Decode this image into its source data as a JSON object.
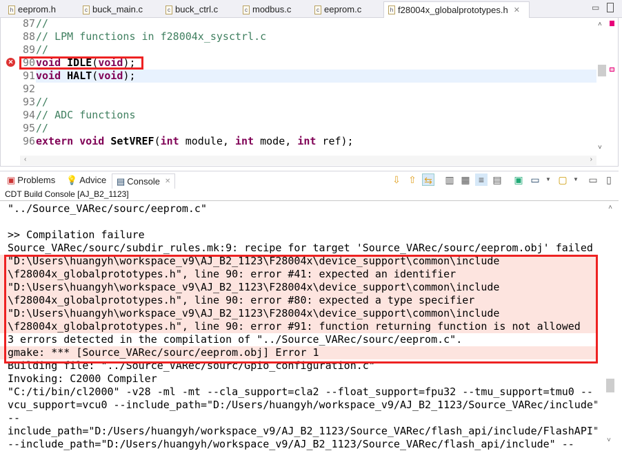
{
  "editor_tabs": [
    {
      "label": "eeprom.h",
      "icon": "h-file-icon"
    },
    {
      "label": "buck_main.c",
      "icon": "c-file-icon"
    },
    {
      "label": "buck_ctrl.c",
      "icon": "c-file-icon"
    },
    {
      "label": "modbus.c",
      "icon": "c-file-icon"
    },
    {
      "label": "eeprom.c",
      "icon": "c-file-warning-icon"
    },
    {
      "label": "f28004x_globalprototypes.h",
      "icon": "h-file-icon",
      "active": true
    }
  ],
  "editor": {
    "lines": [
      {
        "n": "87",
        "text": "//"
      },
      {
        "n": "88",
        "text": "// LPM functions in f28004x_sysctrl.c"
      },
      {
        "n": "89",
        "text": "//"
      },
      {
        "n": "90",
        "kw1": "void",
        "fn": "IDLE",
        "kw2": "void",
        "error": true
      },
      {
        "n": "91",
        "kw1": "void",
        "fn": "HALT",
        "kw2": "void"
      },
      {
        "n": "92",
        "text": ""
      },
      {
        "n": "93",
        "text": "//"
      },
      {
        "n": "94",
        "text": "// ADC functions"
      },
      {
        "n": "95",
        "text": "//"
      },
      {
        "n": "96",
        "kw0": "extern",
        "kw1": "void",
        "fn": "SetVREF",
        "p1": "int",
        "a1": " module, ",
        "p2": "int",
        "a2": " mode, ",
        "p3": "int",
        "a3": " ref);"
      }
    ]
  },
  "panel_tabs": [
    {
      "label": "Problems"
    },
    {
      "label": "Advice"
    },
    {
      "label": "Console",
      "active": true
    }
  ],
  "console": {
    "title": "CDT Build Console [AJ_B2_1123]",
    "lines": [
      "\"../Source_VARec/sourc/eeprom.c\"",
      "",
      ">> Compilation failure",
      "Source_VARec/sourc/subdir_rules.mk:9: recipe for target 'Source_VARec/sourc/eeprom.obj' failed",
      "\"D:\\Users\\huangyh\\workspace_v9\\AJ_B2_1123\\F28004x\\device_support\\common\\include",
      "\\f28004x_globalprototypes.h\", line 90: error #41: expected an identifier",
      "\"D:\\Users\\huangyh\\workspace_v9\\AJ_B2_1123\\F28004x\\device_support\\common\\include",
      "\\f28004x_globalprototypes.h\", line 90: error #80: expected a type specifier",
      "\"D:\\Users\\huangyh\\workspace_v9\\AJ_B2_1123\\F28004x\\device_support\\common\\include",
      "\\f28004x_globalprototypes.h\", line 90: error #91: function returning function is not allowed",
      "3 errors detected in the compilation of \"../Source_VARec/sourc/eeprom.c\".",
      "gmake: *** [Source_VARec/sourc/eeprom.obj] Error 1",
      "Building file: \"../Source_VARec/sourc/Gpio_configuration.c\"",
      "Invoking: C2000 Compiler",
      "\"C:/ti/bin/cl2000\" -v28 -ml -mt --cla_support=cla2 --float_support=fpu32 --tmu_support=tmu0 --",
      "vcu_support=vcu0 --include_path=\"D:/Users/huangyh/workspace_v9/AJ_B2_1123/Source_VARec/include\"",
      "--",
      "include_path=\"D:/Users/huangyh/workspace_v9/AJ_B2_1123/Source_VARec/flash_api/include/FlashAPI\"",
      "--include_path=\"D:/Users/huangyh/workspace_v9/AJ_B2_1123/Source_VARec/flash_api/include\" --"
    ],
    "error_rows": [
      4,
      5,
      6,
      7,
      8,
      9,
      11
    ]
  },
  "colors": {
    "error_highlight": "#ee2222",
    "error_row": "#fde4df",
    "keyword": "#7f0055",
    "comment": "#3f7f5f"
  }
}
